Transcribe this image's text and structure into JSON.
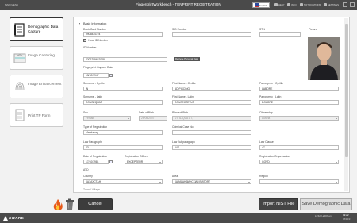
{
  "titlebar": {
    "title": "FingerprintWorkbench - TENPRINT REGISTRATION",
    "menu_label": "MAIN MENU",
    "language": "English",
    "items": [
      "HELP",
      "INFO",
      "NOTIFICATIONS",
      "SETTINGS"
    ]
  },
  "nav": {
    "items": [
      {
        "label": "Demographic Data Capture",
        "active": true
      },
      {
        "label": "Image Capturing",
        "active": false
      },
      {
        "label": "Image Enhancement",
        "active": false
      },
      {
        "label": "Print TP Form",
        "active": false
      }
    ]
  },
  "form": {
    "section_title": "Basic Information",
    "doctocard_label": "DoctoCard Number",
    "doctocard_value": "9905834724",
    "sid_label": "SID Number",
    "sid_value": "",
    "stn_label": "STN",
    "stn_value": "",
    "picture_label": "Picture",
    "have_id_label": "Have ID Number",
    "have_id_checked": true,
    "id_label": "ID Number",
    "id_value": "4206709637028",
    "retrieve_button": "Retrieve Personal Data",
    "capture_date_label": "Fingerprint Capture Date",
    "capture_date_value": "13/12/1947",
    "surname_cyr_label": "Surname - Cyrillic",
    "surname_cyr_value": "IN",
    "firstname_cyr_label": "First Name - Cyrillic",
    "firstname_cyr_value": "ADIPISCING",
    "patronymic_cyr_label": "Patronymic - Cyrillic",
    "patronymic_cyr_value": "LABORE",
    "surname_lat_label": "Surname - Latin",
    "surname_lat_value": "CONSEQUAT",
    "firstname_lat_label": "First Name - Latin",
    "firstname_lat_value": "CONSECTETUR",
    "patronymic_lat_label": "Patronymic - Latin",
    "patronymic_lat_value": "DOLORE",
    "sex_label": "Sex",
    "sex_value": "Female",
    "dob_label": "Date of Birth",
    "dob_value": "26/05/2007",
    "pob_label": "Place of Birth",
    "pob_value": "UT ALIQUA UT,",
    "citizenship_label": "Citizenship",
    "citizenship_value": "Austria",
    "reg_type_label": "Type of Registration",
    "reg_type_value": "Mandatory",
    "criminal_label": "Criminal Case No.",
    "criminal_value": "",
    "law_paragraph_label": "Law Paragraph",
    "law_paragraph_value": "43",
    "law_subparagraph_label": "Law Subparagraph",
    "law_subparagraph_value": "547",
    "law_clause_label": "Law Clause",
    "law_clause_value": "47",
    "reg_date_label": "Date of Registration",
    "reg_date_value": "17/10/1981",
    "reg_officer_label": "Registration Officer",
    "reg_officer_value": "EXCEPTEUR",
    "reg_org_label": "Registration Organisation",
    "reg_org_value": "GOVD",
    "atd_label": "ATD",
    "country_label": "Country",
    "country_value": "КАЗАХСТАН",
    "area_label": "Area",
    "area_value": "КАРАГАНДИНСКИЙ ВИЛОЯТ",
    "region_label": "Region",
    "region_value": "",
    "more_label": "Town / Village"
  },
  "buttons": {
    "cancel": "Cancel",
    "import_nist": "Import NIST File",
    "save": "Save Demographic Data"
  },
  "footer": {
    "brand": "AWARE",
    "time": "09:22",
    "date": "08/12/17",
    "user": "LINUX-2007 en"
  }
}
